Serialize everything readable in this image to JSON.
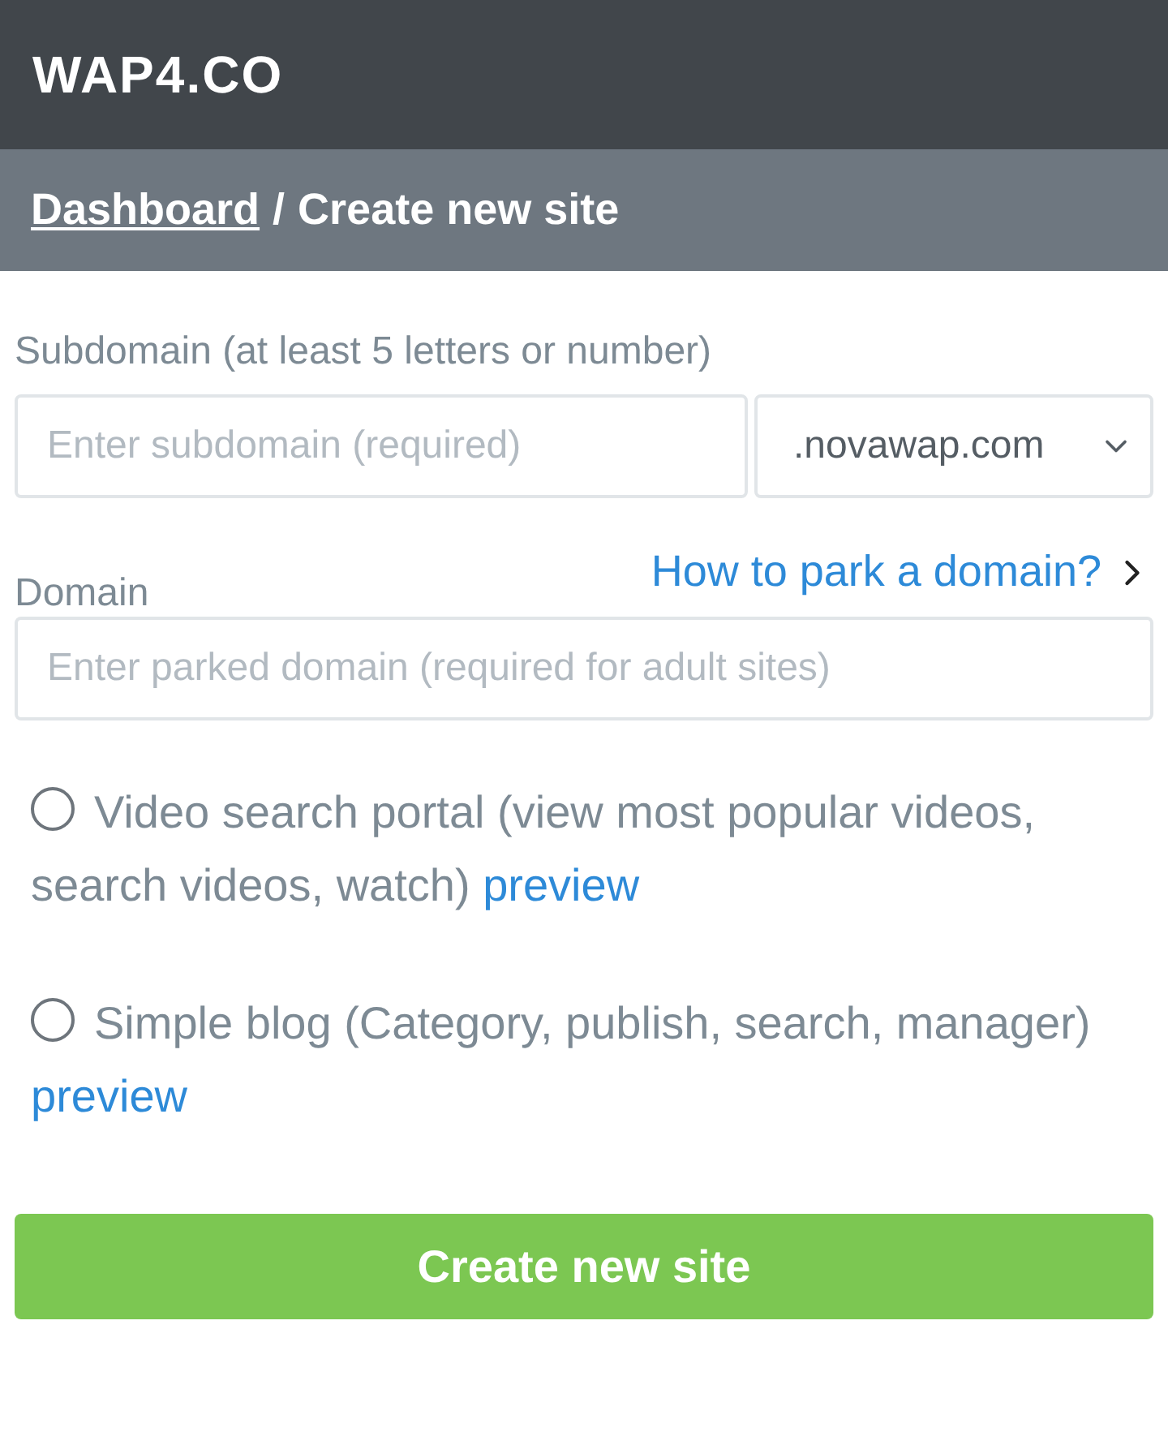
{
  "header": {
    "logo": "WAP4.CO"
  },
  "breadcrumb": {
    "link": "Dashboard",
    "separator": "/",
    "current": "Create new site"
  },
  "form": {
    "subdomain": {
      "label": "Subdomain (at least 5 letters or number)",
      "placeholder": "Enter subdomain (required)",
      "suffix": ".novawap.com"
    },
    "domain": {
      "label": "Domain",
      "help_link": "How to park a domain?",
      "placeholder": "Enter parked domain (required for adult sites)"
    },
    "templates": [
      {
        "text": "Video search portal (view most popular videos, search videos, watch)",
        "link": "preview",
        "selected": false
      },
      {
        "text": "Simple blog (Category, publish, search, manager)",
        "link": "preview",
        "selected": false
      }
    ],
    "submit": "Create new site"
  }
}
